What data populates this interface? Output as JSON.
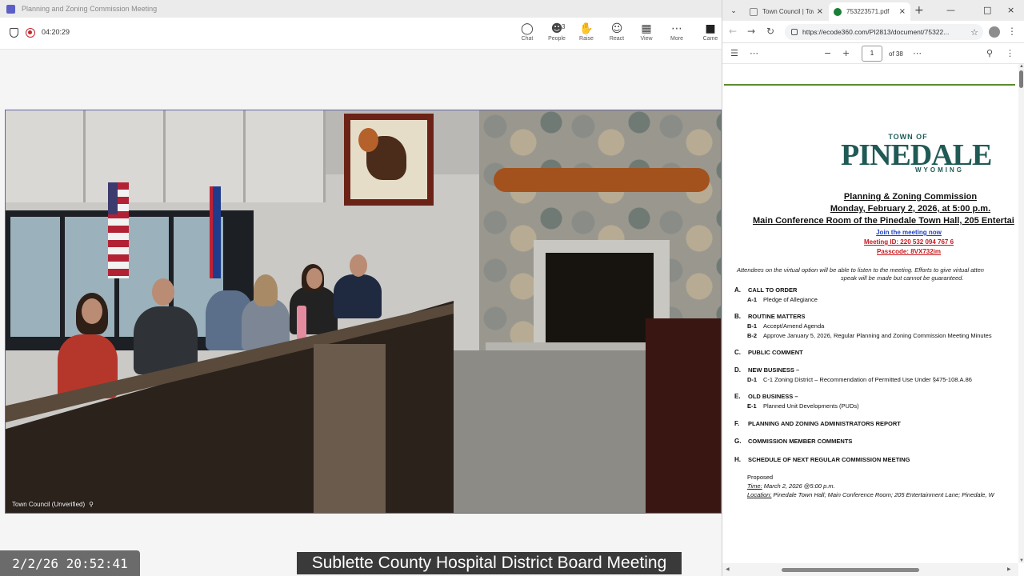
{
  "teams": {
    "window_title": "Planning and Zoning Commission Meeting",
    "timer": "04:20:29",
    "toolbar": {
      "chat": "Chat",
      "people": "People",
      "people_count": "3",
      "raise": "Raise",
      "react": "React",
      "view": "View",
      "more": "More",
      "camera": "Came"
    },
    "tile_label": "Town Council (Unverified)"
  },
  "overlay": {
    "timestamp": "2/2/26 20:52:41",
    "caption": "Sublette County Hospital District Board Meeting"
  },
  "browser": {
    "tabs": [
      {
        "title": "Town Council | Tow"
      },
      {
        "title": "753223571.pdf"
      }
    ],
    "url": "https://ecode360.com/PI2813/document/75322...",
    "page_current": "1",
    "page_total": "of 38"
  },
  "pdf": {
    "logo_top": "TOWN OF",
    "logo_main": "PINEDALE",
    "logo_bottom": "WYOMING",
    "heading1": "Planning & Zoning Commission",
    "heading2": "Monday, February 2, 2026, at 5:00 p.m.",
    "heading3": "Main Conference Room of the Pinedale Town Hall, 205 Entertai",
    "join_link": "Join the meeting now",
    "meeting_id": "Meeting ID: 220 532 094 767 6",
    "passcode": "Passcode: 8VX732im",
    "note_line1": "Attendees on the virtual option will be able to listen to the meeting.  Efforts to give virtual atten",
    "note_line2": "speak will be made but cannot be guaranteed.",
    "sections": [
      {
        "letter": "A.",
        "title": "CALL TO ORDER"
      },
      {
        "letter": "B.",
        "title": "ROUTINE MATTERS"
      },
      {
        "letter": "C.",
        "title": "PUBLIC COMMENT"
      },
      {
        "letter": "D.",
        "title": "NEW BUSINESS –"
      },
      {
        "letter": "E.",
        "title": "OLD BUSINESS –"
      },
      {
        "letter": "F.",
        "title": "PLANNING AND ZONING ADMINISTRATORS REPORT"
      },
      {
        "letter": "G.",
        "title": "COMMISSION MEMBER COMMENTS"
      },
      {
        "letter": "H.",
        "title": "SCHEDULE OF NEXT REGULAR COMMISSION MEETING"
      }
    ],
    "items": [
      {
        "num": "A-1",
        "text": "Pledge of Allegiance"
      },
      {
        "num": "B-1",
        "text": "Accept/Amend Agenda"
      },
      {
        "num": "B-2",
        "text": "Approve January 5, 2026, Regular Planning and Zoning Commission Meeting Minutes"
      },
      {
        "num": "D-1",
        "text": "C-1 Zoning District – Recommendation of Permitted Use Under §475-108.A.86"
      },
      {
        "num": "E-1",
        "text": "Planned Unit Developments (PUDs)"
      }
    ],
    "proposed": "Proposed",
    "time_label": "Time:",
    "time_value": " March 2, 2026 @5:00 p.m.",
    "location_label": "Location:",
    "location_value": " Pinedale Town Hall; Main Conference Room; 205 Entertainment Lane; Pinedale, W"
  }
}
